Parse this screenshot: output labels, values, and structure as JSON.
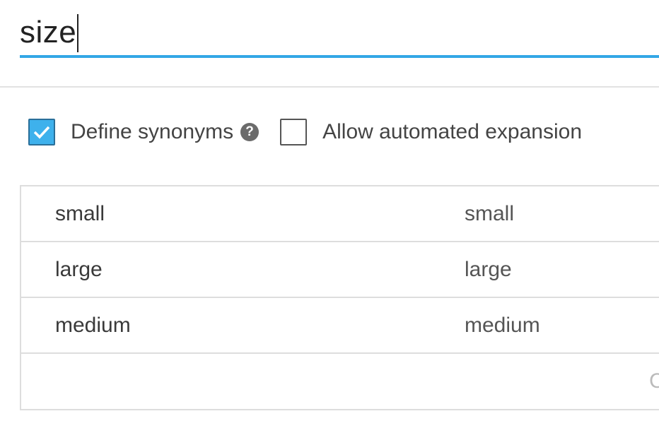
{
  "entity": {
    "name": "size"
  },
  "options": {
    "define_synonyms": {
      "label": "Define synonyms",
      "checked": true
    },
    "allow_expansion": {
      "label": "Allow automated expansion",
      "checked": false
    },
    "help_glyph": "?"
  },
  "entries": [
    {
      "value": "small",
      "synonyms": "small"
    },
    {
      "value": "large",
      "synonyms": "large"
    },
    {
      "value": "medium",
      "synonyms": "medium"
    }
  ],
  "new_entry": {
    "value": "",
    "synonyms_placeholder": "C"
  },
  "colors": {
    "accent": "#33a7e6",
    "checkbox_checked": "#3eb1ec"
  }
}
